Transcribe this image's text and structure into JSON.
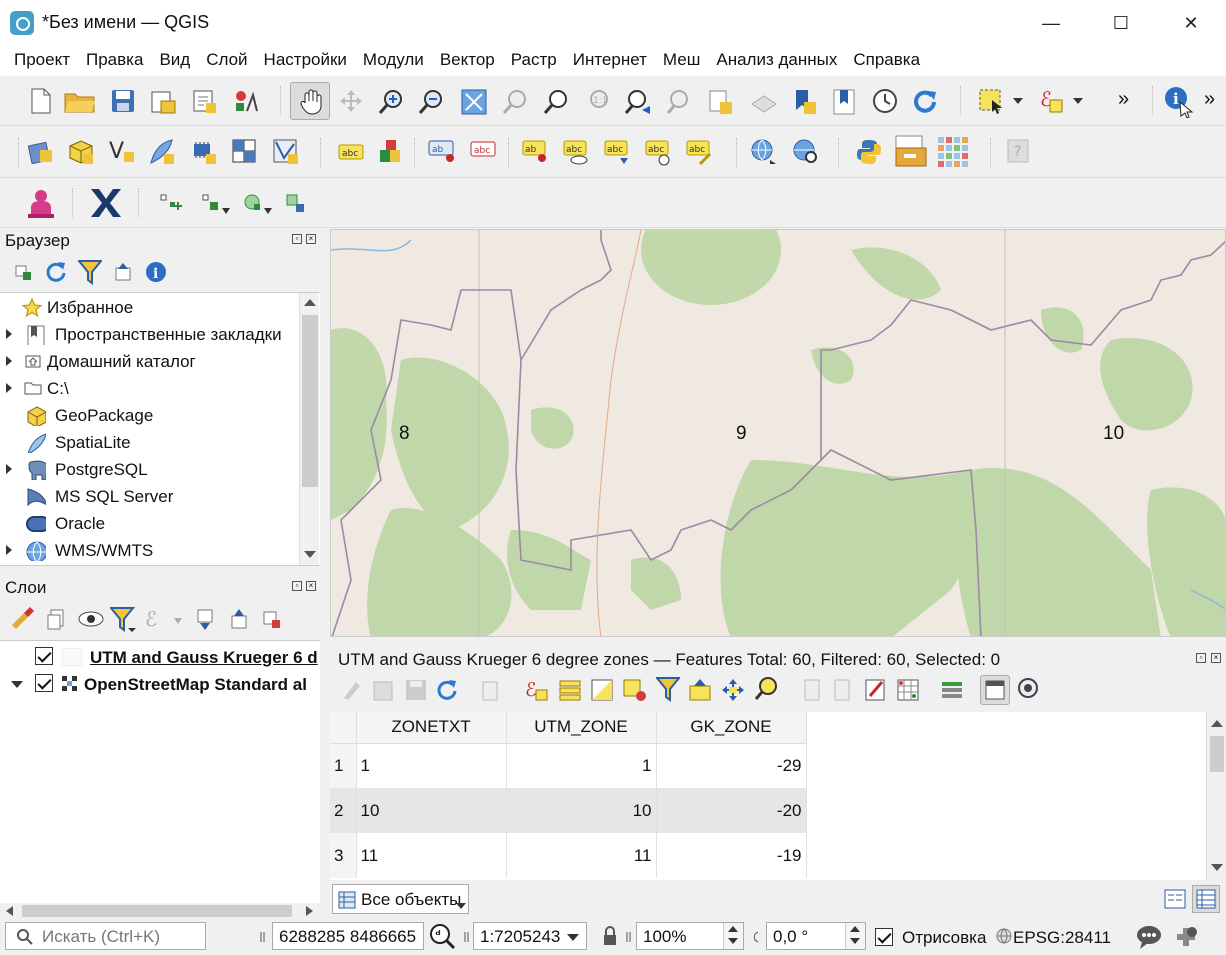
{
  "window": {
    "title": "*Без имени — QGIS",
    "controls": {
      "minimize": "—",
      "maximize": "☐",
      "close": "✕"
    }
  },
  "menu": [
    "Проект",
    "Правка",
    "Вид",
    "Слой",
    "Настройки",
    "Модули",
    "Вектор",
    "Растр",
    "Интернет",
    "Меш",
    "Анализ данных",
    "Справка"
  ],
  "toolbar": {
    "overflow_1": "»",
    "overflow_2": "»"
  },
  "browser_panel": {
    "title": "Браузер",
    "items": [
      {
        "label": "Избранное",
        "icon": "star-icon",
        "expandable": false
      },
      {
        "label": "Пространственные закладки",
        "icon": "bookmark-icon",
        "expandable": true
      },
      {
        "label": "Домашний каталог",
        "icon": "home-folder-icon",
        "expandable": true
      },
      {
        "label": "C:\\",
        "icon": "folder-icon",
        "expandable": true
      },
      {
        "label": "GeoPackage",
        "icon": "geopackage-icon",
        "expandable": false
      },
      {
        "label": "SpatiaLite",
        "icon": "feather-icon",
        "expandable": false
      },
      {
        "label": "PostgreSQL",
        "icon": "elephant-icon",
        "expandable": true
      },
      {
        "label": "MS SQL Server",
        "icon": "mssql-icon",
        "expandable": false
      },
      {
        "label": "Oracle",
        "icon": "oracle-icon",
        "expandable": false
      },
      {
        "label": "WMS/WMTS",
        "icon": "globe-icon",
        "expandable": true
      }
    ]
  },
  "layers_panel": {
    "title": "Слои",
    "layers": [
      {
        "name": "UTM and Gauss Krueger 6 d",
        "checked": true
      },
      {
        "name": "OpenStreetMap Standard al",
        "checked": true
      }
    ]
  },
  "map": {
    "zone_labels": [
      "8",
      "9",
      "10"
    ]
  },
  "attribute_table": {
    "title": "UTM and Gauss Krueger 6 degree zones — Features Total: 60, Filtered: 60, Selected: 0",
    "columns": [
      "ZONETXT",
      "UTM_ZONE",
      "GK_ZONE"
    ],
    "rows": [
      {
        "n": "1",
        "ZONETXT": "1",
        "UTM_ZONE": "1",
        "GK_ZONE": "-29"
      },
      {
        "n": "2",
        "ZONETXT": "10",
        "UTM_ZONE": "10",
        "GK_ZONE": "-20"
      },
      {
        "n": "3",
        "ZONETXT": "11",
        "UTM_ZONE": "11",
        "GK_ZONE": "-19"
      }
    ],
    "filter_button": "Все объекты"
  },
  "statusbar": {
    "search_placeholder": "Искать (Ctrl+K)",
    "coordinate": "6288285 8486665",
    "scale": "1:7205243",
    "magnifier": "100%",
    "rotation": "0,0 °",
    "render_label": "Отрисовка",
    "render_checked": true,
    "crs": "EPSG:28411"
  }
}
